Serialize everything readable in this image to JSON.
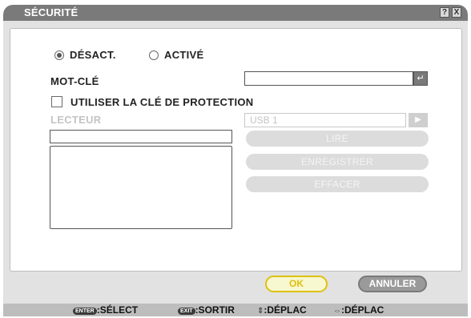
{
  "window": {
    "title": "SÉCURITÉ",
    "help_glyph": "?",
    "close_glyph": "X"
  },
  "mode": {
    "options": [
      {
        "label": "DÉSACT.",
        "selected": true
      },
      {
        "label": "ACTIVÉ",
        "selected": false
      }
    ]
  },
  "keyword": {
    "label": "MOT-CLÉ",
    "value": "",
    "enter_glyph": "↵"
  },
  "protect_key": {
    "label": "UTILISER LA CLÉ DE PROTECTION",
    "checked": false
  },
  "reader": {
    "label": "LECTEUR",
    "device": "USB 1",
    "device_arrow": "▶",
    "field_value": ""
  },
  "actions": {
    "read": "LIRE",
    "register": "ENREGISTRER",
    "delete": "EFFACER"
  },
  "buttons": {
    "ok": "OK",
    "cancel": "ANNULER"
  },
  "footer": {
    "enter_key": "ENTER",
    "enter_text": ":SÉLECT",
    "exit_key": "EXIT",
    "exit_text": ":SORTIR",
    "updown_glyph": "⇕",
    "updown_text": ":DÉPLAC",
    "leftright_glyph": "⇔",
    "leftright_text": ":DÉPLAC"
  },
  "colors": {
    "titlebar": "#7a7a7a",
    "ok_accent": "#e0c010",
    "disabled_text": "#c4c4c4"
  }
}
